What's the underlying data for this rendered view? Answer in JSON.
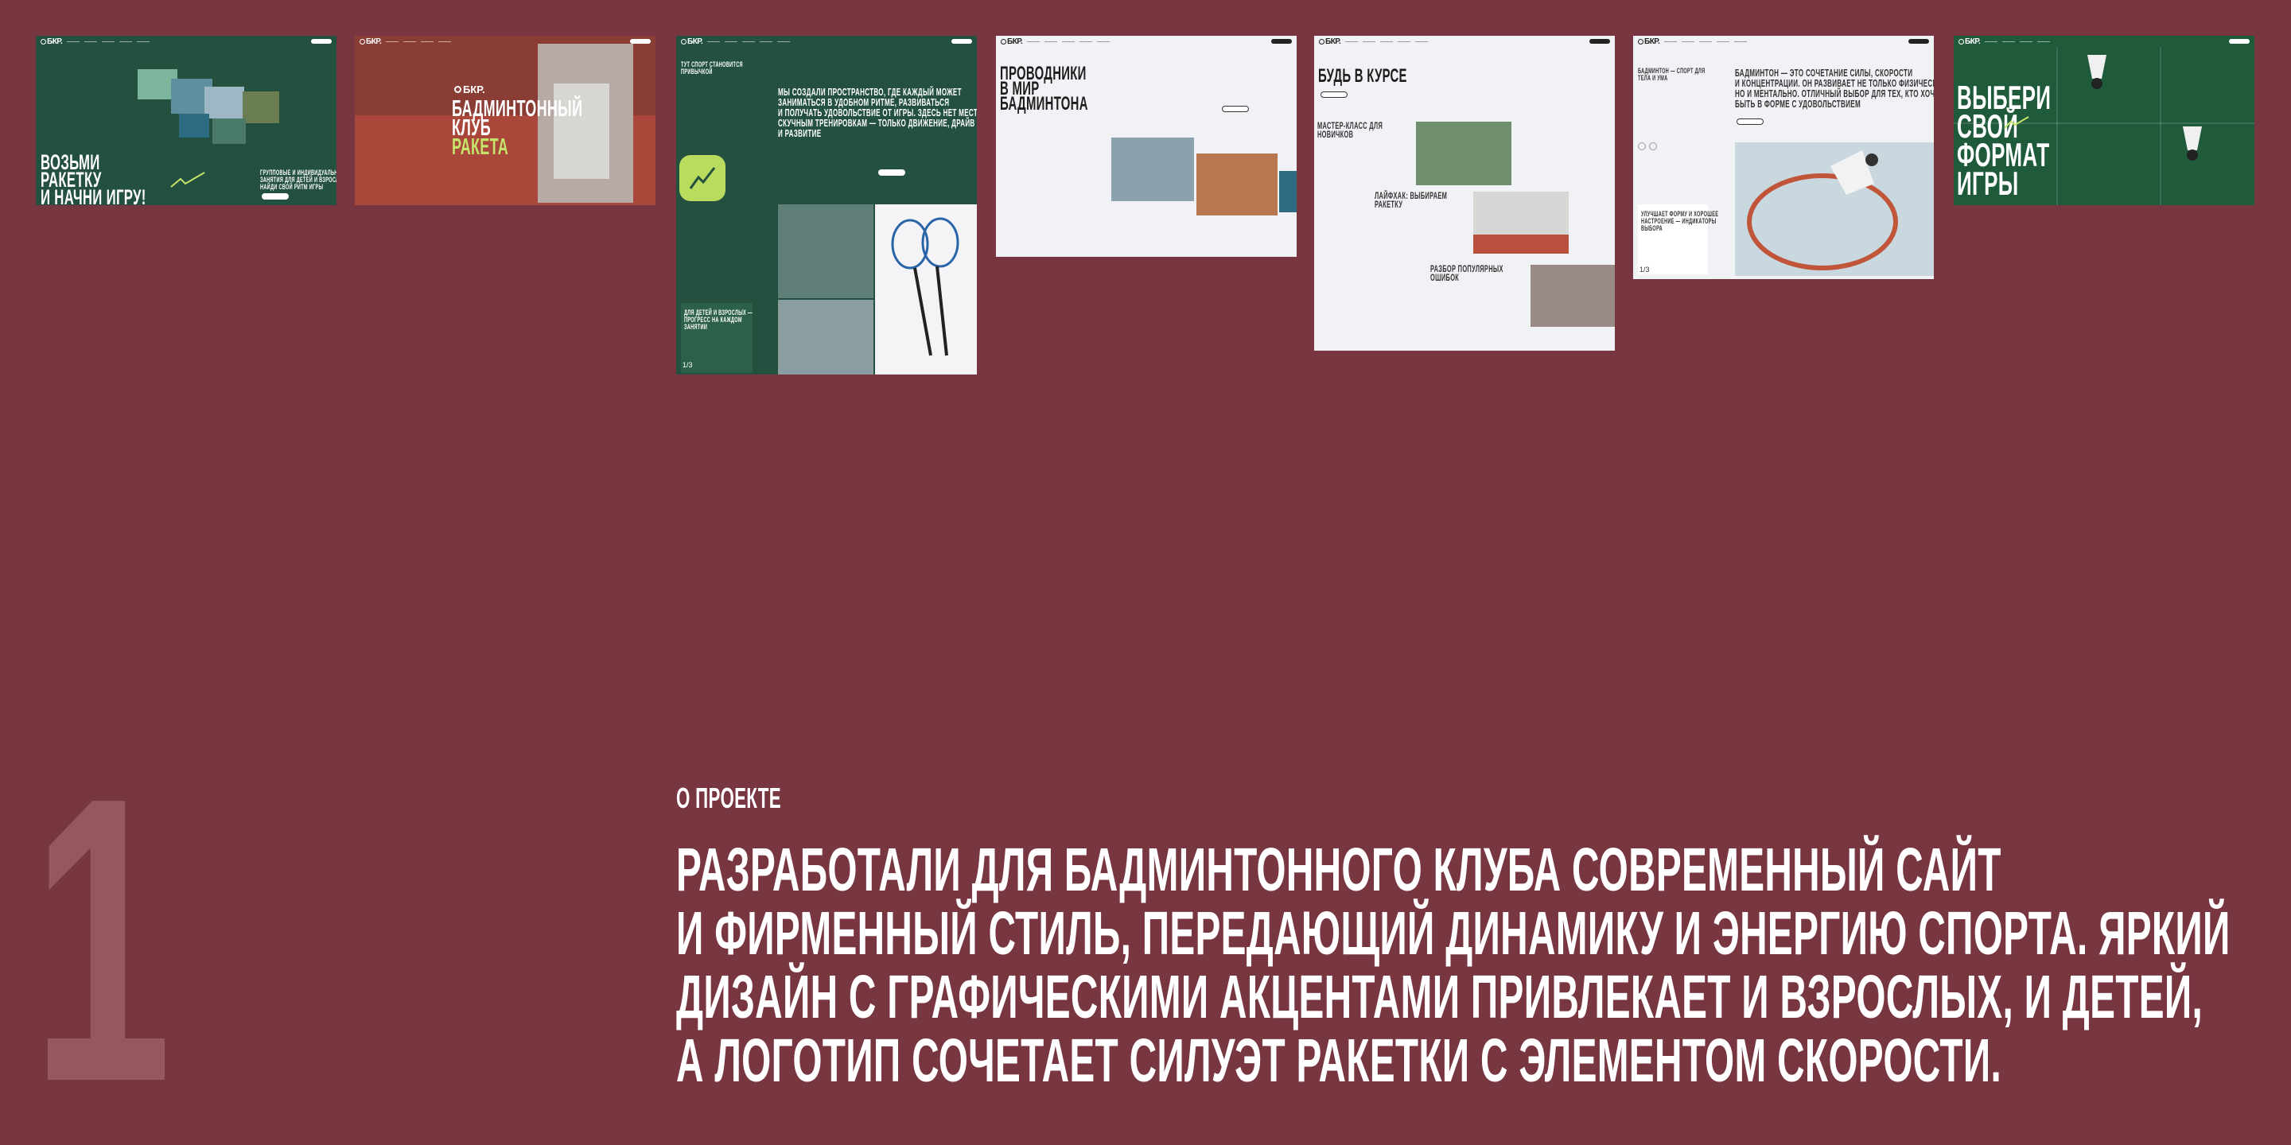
{
  "thumbs": {
    "t1": {
      "logo": "БКР.",
      "heading": [
        "ВОЗЬМИ",
        "РАКЕТКУ",
        "И НАЧНИ ИГРУ!"
      ],
      "sub": [
        "ГРУППОВЫЕ И ИНДИВИДУАЛЬНЫЕ",
        "ЗАНЯТИЯ ДЛЯ ДЕТЕЙ И ВЗРОСЛЫХ.",
        "НАЙДИ СВОЙ РИТМ ИГРЫ"
      ]
    },
    "t2": {
      "logo": "БКР.",
      "heading": [
        "БАДМИНТОННЫЙ",
        "КЛУБ"
      ],
      "accent": "РАКЕТА"
    },
    "t3": {
      "logo": "БКР.",
      "tag": [
        "ТУТ СПОРТ СТАНОВИТСЯ",
        "ПРИВЫЧКОЙ"
      ],
      "heading": [
        "МЫ СОЗДАЛИ ПРОСТРАНСТВО, ГДЕ КАЖДЫЙ МОЖЕТ",
        "ЗАНИМАТЬСЯ В УДОБНОМ РИТМЕ, РАЗВИВАТЬСЯ",
        "И ПОЛУЧАТЬ УДОВОЛЬСТВИЕ ОТ ИГРЫ. ЗДЕСЬ НЕТ МЕСТА",
        "СКУЧНЫМ ТРЕНИРОВКАМ — ТОЛЬКО ДВИЖЕНИЕ, ДРАЙВ",
        "И РАЗВИТИЕ"
      ],
      "card": [
        "ДЛЯ ДЕТЕЙ И ВЗРОСЛЫХ —",
        "ПРОГРЕСС НА КАЖДОМ",
        "ЗАНЯТИИ"
      ],
      "counter": "1/3"
    },
    "t4": {
      "logo": "БКР.",
      "heading": [
        "ПРОВОДНИКИ",
        "В МИР",
        "БАДМИНТОНА"
      ]
    },
    "t5": {
      "logo": "БКР.",
      "heading": "БУДЬ В КУРСЕ",
      "items": [
        [
          "МАСТЕР-КЛАСС ДЛЯ",
          "НОВИЧКОВ"
        ],
        [
          "ЛАЙФХАК: ВЫБИРАЕМ",
          "РАКЕТКУ"
        ],
        [
          "РАЗБОР ПОПУЛЯРНЫХ",
          "ОШИБОК"
        ]
      ]
    },
    "t6": {
      "logo": "БКР.",
      "tag": [
        "БАДМИНТОН — СПОРТ ДЛЯ",
        "ТЕЛА И УМА"
      ],
      "heading": [
        "БАДМИНТОН — ЭТО СОЧЕТАНИЕ СИЛЫ, СКОРОСТИ",
        "И КОНЦЕНТРАЦИИ. ОН РАЗВИВАЕТ НЕ ТОЛЬКО ФИЗИЧЕСКИ,",
        "НО И МЕНТАЛЬНО. ОТЛИЧНЫЙ ВЫБОР ДЛЯ ТЕХ, КТО ХОЧЕТ",
        "БЫТЬ В ФОРМЕ С УДОВОЛЬСТВИЕМ"
      ],
      "card": [
        "УЛУЧШАЕТ ФОРМУ И ХОРОШЕЕ",
        "НАСТРОЕНИЕ — ИНДИКАТОРЫ",
        "ВЫБОРА"
      ],
      "counter": "1/3"
    },
    "t7": {
      "logo": "БКР.",
      "heading": [
        "ВЫБЕРИ",
        "СВОЙ",
        "ФОРМАТ",
        "ИГРЫ"
      ]
    }
  },
  "main": {
    "number": "1",
    "section_label": "О ПРОЕКТЕ",
    "description": [
      "РАЗРАБОТАЛИ ДЛЯ БАДМИНТОННОГО КЛУБА СОВРЕМЕННЫЙ САЙТ",
      "И ФИРМЕННЫЙ СТИЛЬ, ПЕРЕДАЮЩИЙ ДИНАМИКУ И ЭНЕРГИЮ СПОРТА. ЯРКИЙ",
      "ДИЗАЙН С ГРАФИЧЕСКИМИ АКЦЕНТАМИ ПРИВЛЕКАЕТ И ВЗРОСЛЫХ, И ДЕТЕЙ,",
      "А ЛОГОТИП СОЧЕТАЕТ СИЛУЭТ РАКЕТКИ С ЭЛЕМЕНТОМ СКОРОСТИ."
    ]
  },
  "colors": {
    "background": "#783641",
    "brand_green": "#23503f",
    "accent_lime": "#c5e46a",
    "number": "#95585f"
  }
}
